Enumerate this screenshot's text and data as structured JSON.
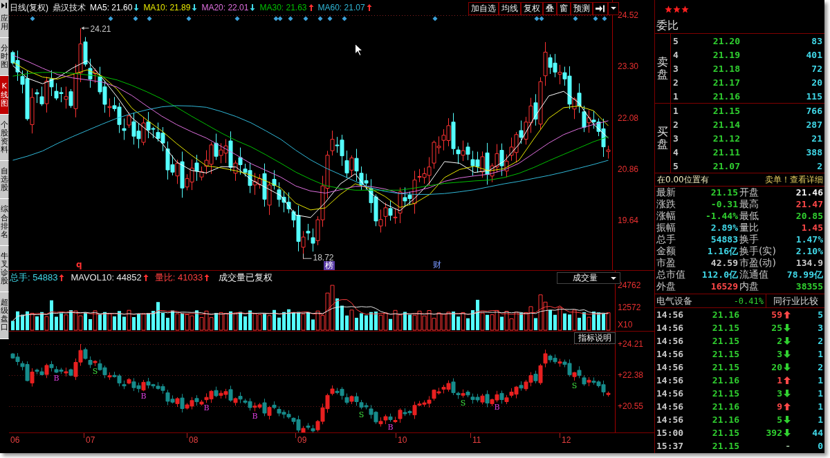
{
  "sidebar": {
    "app_button": {
      "label": "应用"
    },
    "tabs": [
      {
        "label": "分时图",
        "selected": false
      },
      {
        "label": "K线图",
        "selected": true
      },
      {
        "label": "个股资料",
        "selected": false
      },
      {
        "label": "自选股",
        "selected": false
      },
      {
        "label": "综合排名",
        "selected": false
      },
      {
        "label": "牛叉诊股",
        "selected": false
      },
      {
        "label": "超级盘口",
        "selected": false
      }
    ]
  },
  "price_chart": {
    "period": "日线(复权)",
    "stock_name": "鼎汉技术",
    "moving_averages": [
      {
        "label": "MA5: 21.60",
        "rising": false,
        "color": "#ffffff"
      },
      {
        "label": "MA10: 21.89",
        "rising": false,
        "color": "#e8e800"
      },
      {
        "label": "MA20: 22.01",
        "rising": false,
        "color": "#e070e0"
      },
      {
        "label": "MA30: 21.63",
        "rising": true,
        "color": "#00c000"
      },
      {
        "label": "MA60: 21.07",
        "rising": true,
        "color": "#30b8d8"
      }
    ],
    "toolbar": [
      "加自选",
      "均线",
      "复权",
      "叠",
      "窗",
      "预测"
    ],
    "high_label": "24.21",
    "low_label": "18.72",
    "markers": [
      {
        "text": "q",
        "kind": "alert"
      },
      {
        "text": "榜",
        "kind": "tag"
      },
      {
        "text": "财",
        "kind": "finance"
      }
    ],
    "chart_data": {
      "type": "line",
      "ylim": [
        18.46,
        24.88
      ],
      "yticks": [
        {
          "value": 19.64,
          "label": "19.64"
        },
        {
          "value": 20.86,
          "label": "20.86"
        },
        {
          "value": 22.08,
          "label": "22.08"
        },
        {
          "value": 23.3,
          "label": "23.30"
        },
        {
          "value": 24.52,
          "label": "24.52"
        }
      ],
      "categories": [
        null,
        null,
        null,
        null,
        null,
        null,
        null,
        null,
        null,
        null,
        null,
        null,
        null,
        null,
        null,
        null,
        null,
        null,
        null,
        null,
        null,
        null,
        null,
        null,
        null,
        null,
        null,
        null,
        null,
        null,
        null,
        null,
        null,
        null,
        null,
        null,
        null,
        null,
        null,
        null,
        null
      ],
      "series": [
        {
          "color": "#ffffff",
          "values": [
            23.32,
            23.02,
            22.89,
            23.03,
            23.26,
            23.44,
            23.03,
            22.58,
            22.08,
            21.79,
            21.49,
            21.03,
            20.83,
            20.77,
            20.92,
            20.91,
            20.61,
            20.42,
            20.23,
            19.77,
            19.71,
            20.07,
            20.51,
            20.75,
            20.3,
            20.03,
            19.87,
            20.17,
            20.54,
            21.04,
            21.0,
            20.78,
            20.83,
            21.05,
            21.45,
            22.07,
            22.6,
            22.71,
            22.44,
            21.93,
            21.6
          ]
        },
        {
          "color": "#e8e800",
          "values": [
            23.4,
            23.2,
            23.05,
            23.0,
            23.11,
            23.22,
            23.07,
            22.76,
            22.31,
            22.03,
            21.77,
            21.47,
            21.19,
            20.94,
            20.89,
            20.82,
            20.72,
            20.58,
            20.41,
            20.05,
            19.89,
            19.94,
            20.26,
            20.51,
            20.4,
            20.21,
            19.95,
            20.05,
            20.26,
            20.66,
            20.85,
            20.93,
            20.82,
            20.87,
            21.07,
            21.58,
            22.07,
            22.32,
            22.36,
            22.25,
            21.89
          ]
        },
        {
          "color": "#e070e0",
          "values": [
            23.57,
            23.42,
            23.26,
            23.11,
            23.03,
            22.98,
            22.93,
            22.81,
            22.61,
            22.36,
            22.12,
            21.92,
            21.75,
            21.6,
            21.4,
            21.2,
            20.99,
            20.83,
            20.67,
            20.46,
            20.34,
            20.29,
            20.37,
            20.45,
            20.45,
            20.39,
            20.28,
            20.33,
            20.42,
            20.57,
            20.65,
            20.7,
            20.74,
            20.84,
            21.0,
            21.24,
            21.48,
            21.68,
            21.82,
            21.92,
            22.01
          ]
        },
        {
          "color": "#00c000",
          "values": [
            23.07,
            23.13,
            23.16,
            23.16,
            23.14,
            23.1,
            23.06,
            22.98,
            22.85,
            22.7,
            22.53,
            22.33,
            22.12,
            21.92,
            21.72,
            21.54,
            21.39,
            21.2,
            21.0,
            20.79,
            20.62,
            20.47,
            20.4,
            20.36,
            20.36,
            20.36,
            20.36,
            20.41,
            20.47,
            20.52,
            20.55,
            20.58,
            20.6,
            20.66,
            20.76,
            20.9,
            21.06,
            21.21,
            21.36,
            21.51,
            21.63
          ]
        },
        {
          "color": "#30b8d8",
          "values": [
            21.07,
            21.17,
            21.29,
            21.47,
            21.63,
            21.78,
            21.93,
            22.07,
            22.18,
            22.27,
            22.34,
            22.37,
            22.36,
            22.33,
            22.23,
            22.11,
            21.96,
            21.77,
            21.57,
            21.31,
            21.08,
            20.89,
            20.73,
            20.57,
            20.42,
            20.33,
            20.28,
            20.26,
            20.26,
            20.28,
            20.32,
            20.37,
            20.44,
            20.51,
            20.57,
            20.64,
            20.71,
            20.79,
            20.88,
            20.97,
            21.07
          ]
        }
      ]
    }
  },
  "volume_chart": {
    "legend": [
      {
        "label": "总手: 54883",
        "rising": true,
        "color": "#40d8e8"
      },
      {
        "label": "MAVOL10: 44852",
        "rising": true,
        "color": "#e8e8e8"
      },
      {
        "label": "量比: 41033",
        "rising": true,
        "color": "#ff4040"
      }
    ],
    "note": "成交量已复权",
    "indicator": "成交量",
    "axis": [
      "24762",
      "12572",
      "X10"
    ]
  },
  "indicator_chart": {
    "help_button": "指标说明",
    "axis": [
      "+24.21",
      "+22.38",
      "+20.55"
    ],
    "signals": [
      {
        "text": "B",
        "kind": "buy"
      },
      {
        "text": "S",
        "kind": "sell"
      },
      {
        "text": "B",
        "kind": "buy"
      },
      {
        "text": "B",
        "kind": "buy"
      },
      {
        "text": "B",
        "kind": "buy"
      },
      {
        "text": "S",
        "kind": "sell"
      },
      {
        "text": "B",
        "kind": "buy"
      },
      {
        "text": "S",
        "kind": "sell"
      },
      {
        "text": "B",
        "kind": "buy"
      },
      {
        "text": "S",
        "kind": "sell"
      }
    ]
  },
  "x_axis": [
    "06",
    "07",
    "08",
    "09",
    "10",
    "11",
    "12"
  ],
  "quote": {
    "stars": 3,
    "ratio_label": "委比",
    "sell_label": "卖盘",
    "buy_label": "买盘",
    "sell": [
      {
        "rank": "5",
        "price": "21.20",
        "volume": "83"
      },
      {
        "rank": "4",
        "price": "21.19",
        "volume": "401"
      },
      {
        "rank": "3",
        "price": "21.18",
        "volume": "72"
      },
      {
        "rank": "2",
        "price": "21.17",
        "volume": "20"
      },
      {
        "rank": "1",
        "price": "21.16",
        "volume": "115"
      }
    ],
    "buy": [
      {
        "rank": "1",
        "price": "21.15",
        "volume": "766"
      },
      {
        "rank": "2",
        "price": "21.14",
        "volume": "287"
      },
      {
        "rank": "3",
        "price": "21.12",
        "volume": "21"
      },
      {
        "rank": "4",
        "price": "21.11",
        "volume": "388"
      },
      {
        "rank": "5",
        "price": "21.07",
        "volume": "2"
      }
    ],
    "notice": "在0.00位置有",
    "notice_link": "卖单！查看详细",
    "stats": [
      {
        "label": "最新",
        "value": "21.15",
        "color": "#30d030"
      },
      {
        "label": "开盘",
        "value": "21.46",
        "color": "#f4f4f4"
      },
      {
        "label": "涨跌",
        "value": "-0.31",
        "color": "#30d030"
      },
      {
        "label": "最高",
        "value": "21.47",
        "color": "#ff4848"
      },
      {
        "label": "涨幅",
        "value": "-1.44%",
        "color": "#30d030"
      },
      {
        "label": "最低",
        "value": "20.85",
        "color": "#30d030"
      },
      {
        "label": "振幅",
        "value": "2.89%",
        "color": "#40d8e8"
      },
      {
        "label": "量比",
        "value": "1.45",
        "color": "#ff4848"
      },
      {
        "label": "总手",
        "value": "54883",
        "color": "#40d8e8"
      },
      {
        "label": "换手",
        "value": "1.47%",
        "color": "#40d8e8"
      },
      {
        "label": "金额",
        "value": "1.16亿",
        "color": "#40d8e8"
      },
      {
        "label": "换手(实)",
        "value": "2.10%",
        "color": "#40d8e8"
      },
      {
        "label": "市盈",
        "value": "42.59",
        "color": "#c8c8c8"
      },
      {
        "label": "市盈(动)",
        "value": "134.9",
        "color": "#c8c8c8"
      },
      {
        "label": "总市值",
        "value": "112.0亿",
        "color": "#40d8e8"
      },
      {
        "label": "流通值",
        "value": "78.99亿",
        "color": "#40d8e8"
      },
      {
        "label": "外盘",
        "value": "16529",
        "color": "#ff4848"
      },
      {
        "label": "内盘",
        "value": "38355",
        "color": "#30d030"
      }
    ],
    "sector": "电气设备",
    "sector_change": "-0.41%",
    "compare_button": "同行业比较",
    "ticks": [
      {
        "time": "14:56",
        "price": "21.16",
        "volume": "59",
        "kind": "up",
        "column_4": "5"
      },
      {
        "time": "14:56",
        "price": "21.15",
        "volume": "25",
        "kind": "down",
        "column_4": "3"
      },
      {
        "time": "14:56",
        "price": "21.15",
        "volume": "2",
        "kind": "down",
        "column_4": "2"
      },
      {
        "time": "14:56",
        "price": "21.15",
        "volume": "3",
        "kind": "down",
        "column_4": "1"
      },
      {
        "time": "14:56",
        "price": "21.15",
        "volume": "20",
        "kind": "down",
        "column_4": "2"
      },
      {
        "time": "14:56",
        "price": "21.16",
        "volume": "1",
        "kind": "up",
        "column_4": "1"
      },
      {
        "time": "14:56",
        "price": "21.15",
        "volume": "3",
        "kind": "down",
        "column_4": "1"
      },
      {
        "time": "14:56",
        "price": "21.16",
        "volume": "9",
        "kind": "up",
        "column_4": "1"
      },
      {
        "time": "14:56",
        "price": "21.16",
        "volume": "5",
        "kind": "down",
        "column_4": "1"
      },
      {
        "time": "15:00",
        "price": "21.15",
        "volume": "392",
        "kind": "down",
        "column_4": "44"
      },
      {
        "time": "15:37",
        "price": "21.15",
        "volume": "-",
        "kind": "flat",
        "column_4": "0"
      }
    ]
  }
}
